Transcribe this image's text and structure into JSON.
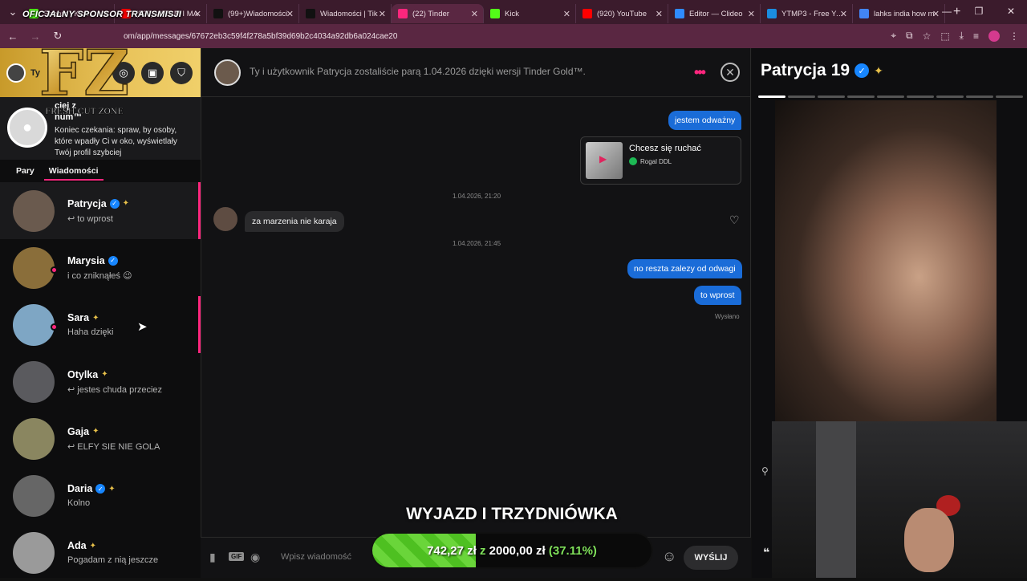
{
  "overlay": {
    "sponsor": "OFICJALNY SPONSOR TRANSMISJI",
    "logo_letters": "FZ",
    "logo_text": "FRESH CUT ZONE",
    "title": "WYJAZD I TRZYDNIÓWKA",
    "goal_current": "742,27 zł",
    "goal_sep": "z",
    "goal_target": "2000,00 zł",
    "goal_percent": "(37.11%)",
    "goal_fraction": 0.3711
  },
  "browser": {
    "tabs": [
      {
        "title": "Stream | Kick Cons",
        "color": "#53fc18"
      },
      {
        "title": "(920) WITAM I MA",
        "color": "#ff0000"
      },
      {
        "title": "(99+)Wiadomości",
        "color": "#111111"
      },
      {
        "title": "Wiadomości | Tik",
        "color": "#111111"
      },
      {
        "title": "(22) Tinder",
        "color": "#fd267d"
      },
      {
        "title": "Kick",
        "color": "#53fc18"
      },
      {
        "title": "(920) YouTube",
        "color": "#ff0000"
      },
      {
        "title": "Editor — Clideo",
        "color": "#2f8cff"
      },
      {
        "title": "YTMP3 - Free You",
        "color": "#1a8de0"
      },
      {
        "title": "lahks india how m",
        "color": "#4285f4"
      }
    ],
    "url": "om/app/messages/67672eb3c59f4f278a5bf39d69b2c4034a92db6a024cae20"
  },
  "sidebar": {
    "user_initial": "Ty",
    "promo_title": "ciej z\nnum™",
    "promo_text": "Koniec czekania: spraw, by osoby, które wpadły Ci w oko, wyświetlały Twój profil szybciej",
    "tab_pairs": "Pary",
    "tab_messages": "Wiadomości",
    "conversations": [
      {
        "name": "Patrycja",
        "verified": true,
        "gold": true,
        "last": "↩ to wprost",
        "online": false,
        "unread": true,
        "avatar": "#6a5a4e"
      },
      {
        "name": "Marysia",
        "verified": true,
        "gold": false,
        "last": "i co zniknąłeś 😉",
        "online": true,
        "unread": false,
        "avatar": "#8a6e3a"
      },
      {
        "name": "Sara",
        "verified": false,
        "gold": true,
        "last": "Haha dzięki",
        "online": true,
        "unread": true,
        "avatar": "#7ea6c4"
      },
      {
        "name": "Otylka",
        "verified": false,
        "gold": true,
        "last": "↩ jestes chuda przeciez",
        "online": false,
        "unread": false,
        "avatar": "#5a5a5e"
      },
      {
        "name": "Gaja",
        "verified": false,
        "gold": true,
        "last": "↩ ELFY SIE NIE GOLA",
        "online": false,
        "unread": false,
        "avatar": "#8a8660"
      },
      {
        "name": "Daria",
        "verified": true,
        "gold": true,
        "last": "Kolno",
        "online": false,
        "unread": false,
        "avatar": "#666"
      },
      {
        "name": "Ada",
        "verified": false,
        "gold": true,
        "last": "Pogadam z nią jeszcze",
        "online": false,
        "unread": false,
        "avatar": "#9a9a9a"
      }
    ]
  },
  "chat": {
    "header": "Ty i użytkownik Patrycja zostaliście parą 1.04.2026 dzięki wersji Tinder Gold™.",
    "messages": {
      "m1": "jestem odważny",
      "spotify_title": "Chcesz się ruchać",
      "spotify_artist": "Rogal DDL",
      "ts1": "1.04.2026, 21:20",
      "m2": "za marzenia nie karaja",
      "ts2": "1.04.2026, 21:45",
      "m3": "no reszta zalezy od odwagi",
      "m4": "to wprost",
      "sent": "Wysłano"
    },
    "composer_placeholder": "Wpisz wiadomość",
    "gif_label": "GIF",
    "send_label": "WYŚLIJ"
  },
  "profile": {
    "name": "Patrycja",
    "age": "19",
    "photo_segments": 9,
    "active_segment": 0
  }
}
